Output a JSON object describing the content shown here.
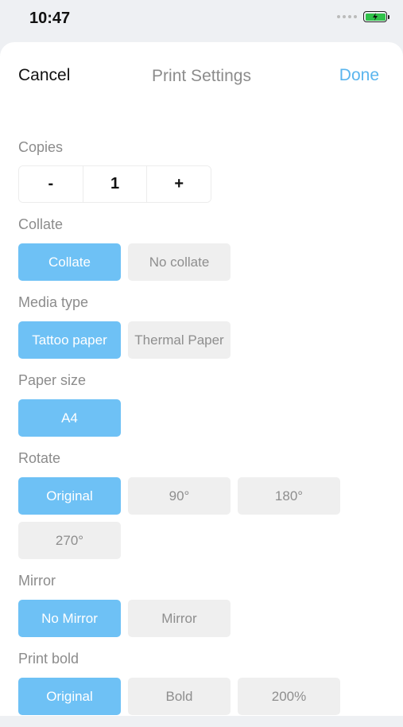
{
  "status": {
    "time": "10:47"
  },
  "nav": {
    "cancel": "Cancel",
    "title": "Print Settings",
    "done": "Done"
  },
  "copies": {
    "label": "Copies",
    "minus": "-",
    "value": "1",
    "plus": "+"
  },
  "collate": {
    "label": "Collate",
    "options": [
      "Collate",
      "No collate"
    ],
    "selected": 0
  },
  "media_type": {
    "label": "Media type",
    "options": [
      "Tattoo paper",
      "Thermal Paper"
    ],
    "selected": 0
  },
  "paper_size": {
    "label": "Paper size",
    "options": [
      "A4"
    ],
    "selected": 0
  },
  "rotate": {
    "label": "Rotate",
    "options": [
      "Original",
      "90°",
      "180°",
      "270°"
    ],
    "selected": 0
  },
  "mirror": {
    "label": "Mirror",
    "options": [
      "No Mirror",
      "Mirror"
    ],
    "selected": 0
  },
  "print_bold": {
    "label": "Print bold",
    "options": [
      "Original",
      "Bold",
      "200%"
    ],
    "selected": 0
  },
  "colors": {
    "accent": "#6ec1f5",
    "done": "#5ab5ee",
    "unselected_bg": "#efefef",
    "battery": "#30c24a"
  }
}
